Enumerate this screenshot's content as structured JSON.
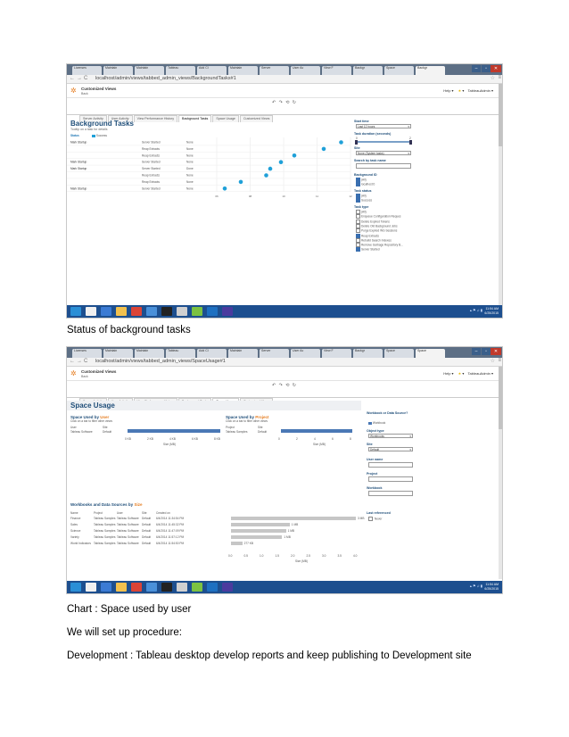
{
  "browser": {
    "url": "localhost/admin/views/tabbed_admin_views/BackgroundTasks#1",
    "url2": "localhost/admin/views/tabbed_admin_views/SpaceUsage#1",
    "tabs1": [
      "Licenses",
      "Maintain",
      "Maintain",
      "Tableau",
      "Add Cl",
      "Maintain",
      "Server",
      "User Ac",
      "View F",
      "Backgr",
      "Space",
      "Backgr"
    ],
    "tabs2": [
      "Licenses",
      "Maintain",
      "Maintain",
      "Tableau",
      "Add Cl",
      "Maintain",
      "Server",
      "User Ac",
      "View F",
      "Backgr",
      "Space",
      "Space"
    ]
  },
  "header": {
    "title": "Customized Views",
    "subtitle": "Back",
    "help": "Help ▾",
    "user": "TableauAdmin ▾"
  },
  "view_tabs": [
    "Server Activity",
    "User Activity",
    "View Performance History",
    "Background Tasks",
    "Space Usage",
    "Customized Views"
  ],
  "shot1": {
    "heading": "Background Tasks",
    "subheading": "Tooltip on a task for details",
    "status_label": "Status",
    "status_legend": "Success",
    "axis_ticks": [
      "06",
      "08",
      "10",
      "11",
      "12"
    ],
    "rows": [
      {
        "name": "Mark Startup",
        "job": "Server Started",
        "sched": "None"
      },
      {
        "name": "",
        "job": "Reap Extracts",
        "sched": "None"
      },
      {
        "name": "",
        "job": "Reap Extracts",
        "sched": "None"
      },
      {
        "name": "Mark Startup",
        "job": "Server Started",
        "sched": "None"
      },
      {
        "name": "Mark Startup",
        "job": "Server Started",
        "sched": "Done"
      },
      {
        "name": "",
        "job": "Reap Extracts",
        "sched": "None"
      },
      {
        "name": "",
        "job": "Reap Extracts",
        "sched": "None"
      },
      {
        "name": "Mark Startup",
        "job": "Server Started",
        "sched": "None"
      }
    ],
    "dot_x": [
      0.93,
      0.8,
      0.58,
      0.48,
      0.4,
      0.37,
      0.18,
      0.06
    ],
    "filters": {
      "start_time": "Start time",
      "start_time_val": "Last 12 hours",
      "duration": "Task duration (seconds)",
      "duration_min": "0",
      "duration_max": "2",
      "site": "Site",
      "site_val": "None (System tasks)",
      "search": "Search by task name",
      "bg_id": "Background ID",
      "bg_items": [
        "(All)",
        "localhost:0"
      ],
      "task_status": "Task status",
      "status_items": [
        "(All)",
        "Success"
      ],
      "task_type": "Task type",
      "type_items": [
        "(All)",
        "Enqueue Configuration Reques",
        "Delete Expired Tokens",
        "Delete Old Background Jobs",
        "Purge Expired WG Sessions",
        "Reap Extracts",
        "Rebuild Search Indexes",
        "Remove Garbage Repository B...",
        "Server Started"
      ],
      "type_checked": [
        false,
        false,
        false,
        false,
        false,
        true,
        false,
        false,
        true
      ]
    }
  },
  "shot2": {
    "heading": "Space Usage",
    "by_user_title_a": "Space Used by",
    "by_user_title_b": "User",
    "by_user_sub": "Click on a bar to filter other views",
    "by_proj_title_a": "Space Used by",
    "by_proj_title_b": "Project",
    "by_proj_sub": "Click on a bar to filter other views",
    "user_cols": [
      "User",
      "Site"
    ],
    "user_row": [
      "Tableau Software",
      "Default"
    ],
    "user_axis": [
      "0 KB",
      "2 KB",
      "4 KB",
      "6 KB",
      "8 KB"
    ],
    "user_axis_label": "Size (MB)",
    "proj_cols": [
      "Project",
      "Site"
    ],
    "proj_row": [
      "Tableau Samples",
      "Default"
    ],
    "proj_axis": [
      "0",
      "2",
      "4",
      "6",
      "8"
    ],
    "proj_axis_label": "Size (MB)",
    "wb_title_a": "Workbooks and Data Sources by",
    "wb_title_b": "Size",
    "wb_cols": [
      "Name",
      "Project",
      "User",
      "Site",
      "Created on"
    ],
    "wb_rows": [
      [
        "Finance",
        "Tableau Samples",
        "Tableau Software",
        "Default",
        "6/4/2014 11:34:54 PM",
        "3 MB"
      ],
      [
        "Sales",
        "Tableau Samples",
        "Tableau Software",
        "Default",
        "6/4/2014 11:45:32 PM",
        "1 MB"
      ],
      [
        "Science",
        "Tableau Samples",
        "Tableau Software",
        "Default",
        "6/4/2014 11:47:09 PM",
        "1 MB"
      ],
      [
        "Variety",
        "Tableau Samples",
        "Tableau Software",
        "Default",
        "6/4/2014 11:57:12 PM",
        "1 MB"
      ],
      [
        "World Indicators",
        "Tableau Samples",
        "Tableau Software",
        "Default",
        "6/4/2014 11:54:50 PM",
        "277 KB"
      ]
    ],
    "wb_bar_frac": [
      1.0,
      0.47,
      0.44,
      0.41,
      0.09
    ],
    "wb_axis": [
      "0.0",
      "0.5",
      "1.0",
      "1.5",
      "2.0",
      "2.5",
      "3.0",
      "3.5",
      "4.0"
    ],
    "wb_axis_label": "Size (MB)",
    "filters": {
      "wb_or_ds": "Workbook or Data Source?",
      "wb_item": "Workbook",
      "object_type": "Object type",
      "object_type_val": "Workbooks",
      "site": "Site",
      "site_val": "Default",
      "user_name": "User name",
      "project": "Project",
      "workbook": "Workbook",
      "last_ref": "Last referenced",
      "last_ref_item": "Never"
    }
  },
  "taskbar": {
    "time": "11:54 AM",
    "date": "6/25/2015"
  },
  "captions": {
    "c1": "Status of background tasks",
    "c2": "Chart : Space used by user",
    "c3": "We will set up procedure:",
    "c4": "Development : Tableau desktop develop reports and keep publishing to Development site"
  },
  "colors": {
    "accent": "#1fa0d8",
    "taskbar": "#1d4f8f",
    "heading": "#1f4e79"
  }
}
